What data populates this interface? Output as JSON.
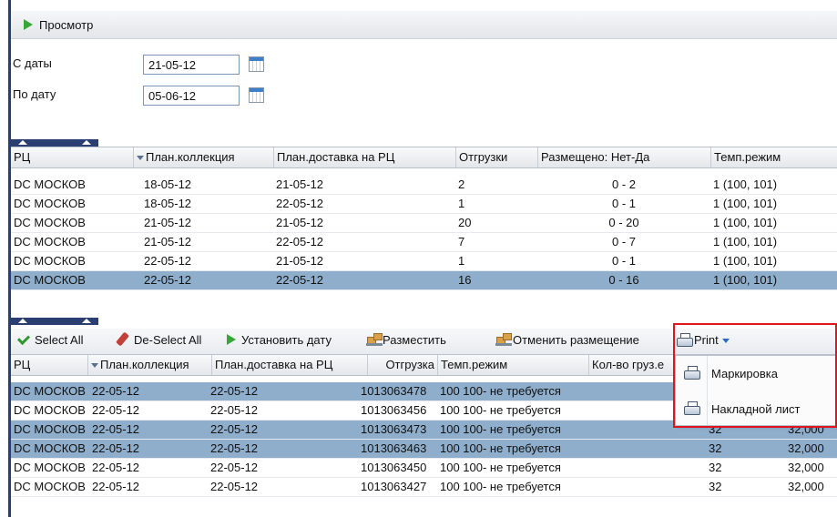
{
  "toolbar": {
    "view_label": "Просмотр"
  },
  "filters": {
    "from_label": "С даты",
    "from_value": "21-05-12",
    "to_label": "По дату",
    "to_value": "05-06-12"
  },
  "grid1": {
    "columns": [
      "РЦ",
      "План.коллекция",
      "План.доставка на РЦ",
      "Отгрузки",
      "Размещено: Нет-Да",
      "Темп.режим"
    ],
    "rows": [
      [
        "DC МОСКОВ",
        "18-05-12",
        "21-05-12",
        "2",
        "0 - 2",
        "1 (100, 101)"
      ],
      [
        "DC МОСКОВ",
        "18-05-12",
        "22-05-12",
        "1",
        "0 - 1",
        "1 (100, 101)"
      ],
      [
        "DC МОСКОВ",
        "21-05-12",
        "21-05-12",
        "20",
        "0 - 20",
        "1 (100, 101)"
      ],
      [
        "DC МОСКОВ",
        "21-05-12",
        "22-05-12",
        "7",
        "0 - 7",
        "1 (100, 101)"
      ],
      [
        "DC МОСКОВ",
        "22-05-12",
        "21-05-12",
        "1",
        "0 - 1",
        "1 (100, 101)"
      ],
      [
        "DC МОСКОВ",
        "22-05-12",
        "22-05-12",
        "16",
        "0 - 16",
        "1 (100, 101)"
      ]
    ]
  },
  "actions": {
    "select_all": "Select All",
    "deselect_all": "De-Select All",
    "set_date": "Установить дату",
    "place": "Разместить",
    "cancel_place": "Отменить размещение",
    "print": "Print"
  },
  "grid2": {
    "columns": [
      "РЦ",
      "План.коллекция",
      "План.доставка на РЦ",
      "Отгрузка",
      "Темп.режим",
      "Кол-во груз.е"
    ],
    "rows": [
      [
        "DC МОСКОВ",
        "22-05-12",
        "22-05-12",
        "1013063478",
        "100 100- не требуется",
        "",
        ""
      ],
      [
        "DC МОСКОВ",
        "22-05-12",
        "22-05-12",
        "1013063456",
        "100 100- не требуется",
        "",
        ""
      ],
      [
        "DC МОСКОВ",
        "22-05-12",
        "22-05-12",
        "1013063473",
        "100 100- не требуется",
        "32",
        "32,000"
      ],
      [
        "DC МОСКОВ",
        "22-05-12",
        "22-05-12",
        "1013063463",
        "100 100- не требуется",
        "32",
        "32,000"
      ],
      [
        "DC МОСКОВ",
        "22-05-12",
        "22-05-12",
        "1013063450",
        "100 100- не требуется",
        "32",
        "32,000"
      ],
      [
        "DC МОСКОВ",
        "22-05-12",
        "22-05-12",
        "1013063427",
        "100 100- не требуется",
        "32",
        "32,000"
      ]
    ]
  },
  "print_menu": {
    "items": [
      "Маркировка",
      "Накладной лист"
    ]
  },
  "colors": {
    "selected_row": "#8faecb",
    "accent_dark": "#2b3f73",
    "highlight_box": "#e0141c"
  }
}
